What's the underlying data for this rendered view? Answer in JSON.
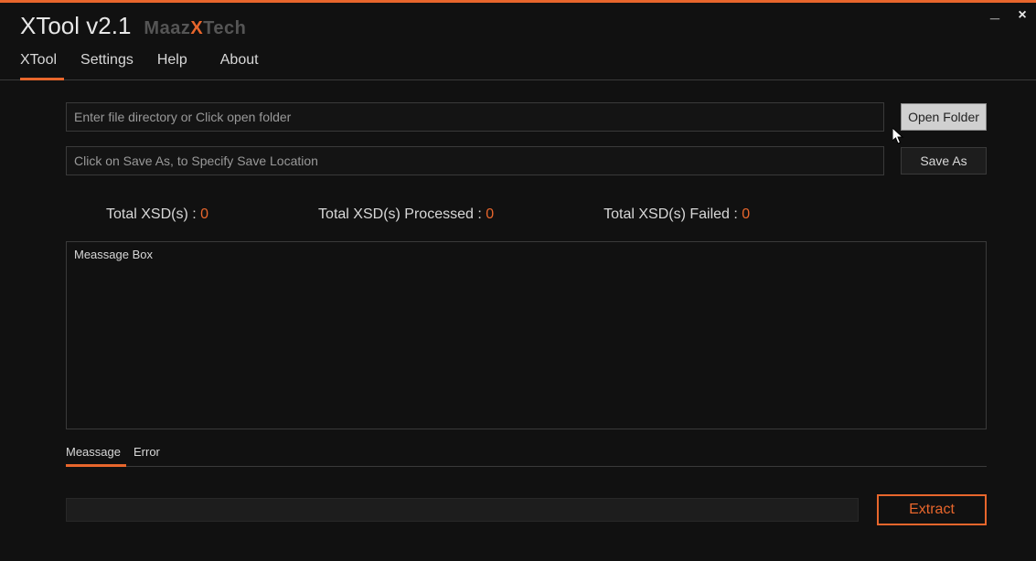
{
  "window": {
    "title": "XTool  v2.1",
    "brand_prefix": "Maaz",
    "brand_x": "X",
    "brand_suffix": "Tech"
  },
  "menu": {
    "items": [
      {
        "label": "XTool",
        "active": true
      },
      {
        "label": "Settings",
        "active": false
      },
      {
        "label": "Help",
        "active": false
      },
      {
        "label": "About",
        "active": false
      }
    ]
  },
  "inputs": {
    "directory": {
      "value": "",
      "placeholder": "Enter file directory or Click open folder"
    },
    "save_location": {
      "value": "",
      "placeholder": "Click on Save As, to Specify Save Location"
    }
  },
  "buttons": {
    "open_folder": "Open Folder",
    "save_as": "Save As",
    "extract": "Extract"
  },
  "stats": {
    "total_label": "Total XSD(s) : ",
    "total_value": "0",
    "processed_label": "Total XSD(s) Processed : ",
    "processed_value": "0",
    "failed_label": "Total XSD(s) Failed : ",
    "failed_value": "0"
  },
  "message_box": {
    "text": "Meassage Box"
  },
  "bottom_tabs": {
    "items": [
      {
        "label": "Meassage",
        "active": true
      },
      {
        "label": "Error",
        "active": false
      }
    ]
  },
  "colors": {
    "accent": "#e8662c",
    "background": "#111111",
    "border": "#3a3a3a"
  }
}
